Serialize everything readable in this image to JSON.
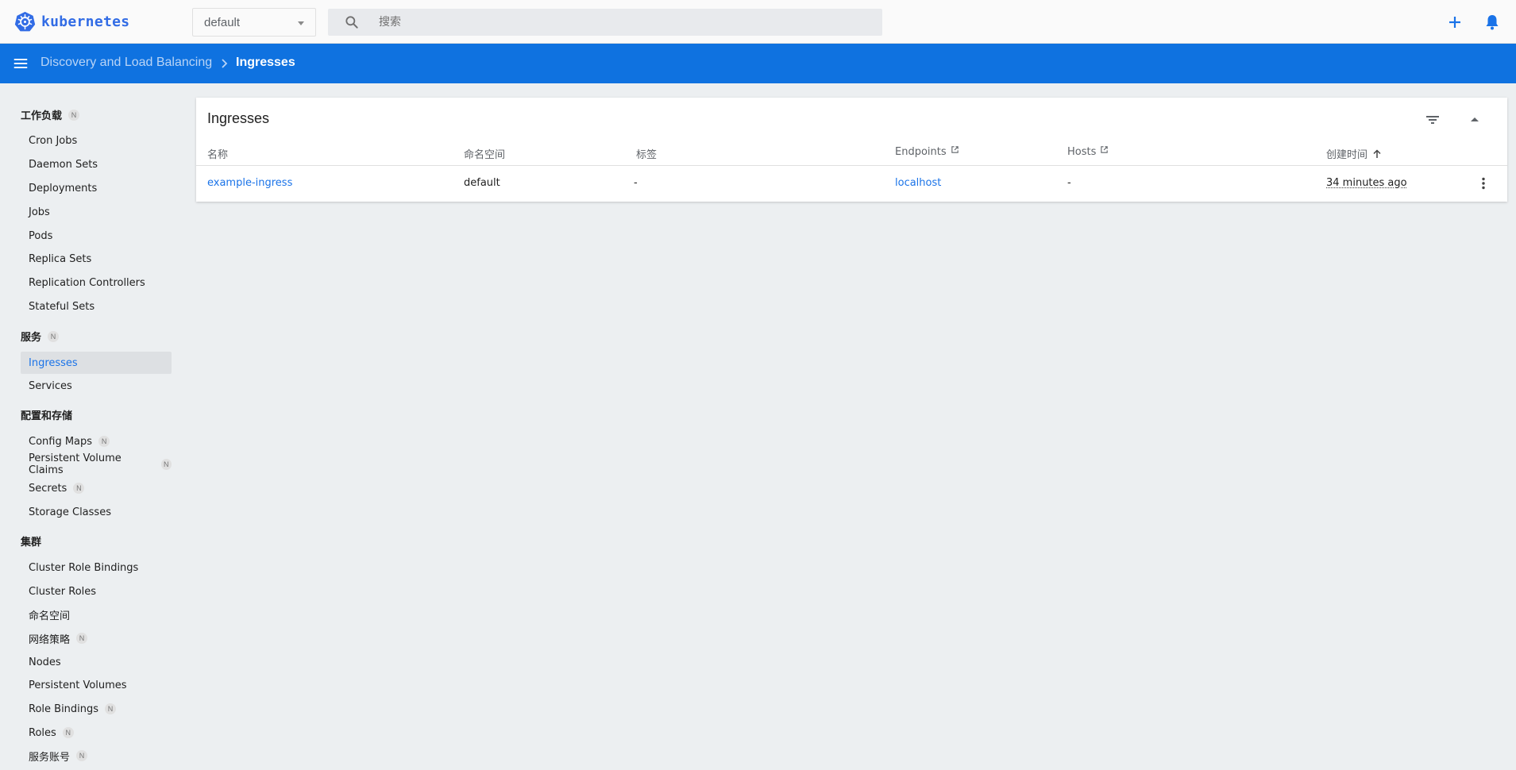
{
  "app": {
    "logo_text": "kubernetes",
    "brand_color": "#326ce5",
    "accent_color": "#0f72e0"
  },
  "header": {
    "namespace_selected": "default",
    "search_placeholder": "搜索",
    "search_value": "",
    "actions": [
      "add-icon",
      "bell-icon"
    ]
  },
  "breadcrumb": {
    "parent": "Discovery and Load Balancing",
    "current": "Ingresses"
  },
  "sidebar": {
    "sections": [
      {
        "title": "工作负载",
        "badge": "N",
        "items": [
          {
            "label": "Cron Jobs"
          },
          {
            "label": "Daemon Sets"
          },
          {
            "label": "Deployments"
          },
          {
            "label": "Jobs"
          },
          {
            "label": "Pods"
          },
          {
            "label": "Replica Sets"
          },
          {
            "label": "Replication Controllers"
          },
          {
            "label": "Stateful Sets"
          }
        ]
      },
      {
        "title": "服务",
        "badge": "N",
        "items": [
          {
            "label": "Ingresses",
            "active": true
          },
          {
            "label": "Services"
          }
        ]
      },
      {
        "title": "配置和存储",
        "badge": "",
        "items": [
          {
            "label": "Config Maps",
            "badge": "N"
          },
          {
            "label": "Persistent Volume Claims",
            "badge": "N"
          },
          {
            "label": "Secrets",
            "badge": "N"
          },
          {
            "label": "Storage Classes"
          }
        ]
      },
      {
        "title": "集群",
        "badge": "",
        "items": [
          {
            "label": "Cluster Role Bindings"
          },
          {
            "label": "Cluster Roles"
          },
          {
            "label": "命名空间"
          },
          {
            "label": "网络策略",
            "badge": "N"
          },
          {
            "label": "Nodes"
          },
          {
            "label": "Persistent Volumes"
          },
          {
            "label": "Role Bindings",
            "badge": "N"
          },
          {
            "label": "Roles",
            "badge": "N"
          },
          {
            "label": "服务账号",
            "badge": "N"
          }
        ]
      }
    ]
  },
  "card": {
    "title": "Ingresses",
    "columns": [
      "名称",
      "命名空间",
      "标签",
      "Endpoints",
      "Hosts",
      "创建时间"
    ],
    "rows": [
      {
        "name": "example-ingress",
        "namespace": "default",
        "labels": "-",
        "endpoints": "localhost",
        "hosts": "-",
        "created": "34 minutes ago"
      }
    ]
  }
}
